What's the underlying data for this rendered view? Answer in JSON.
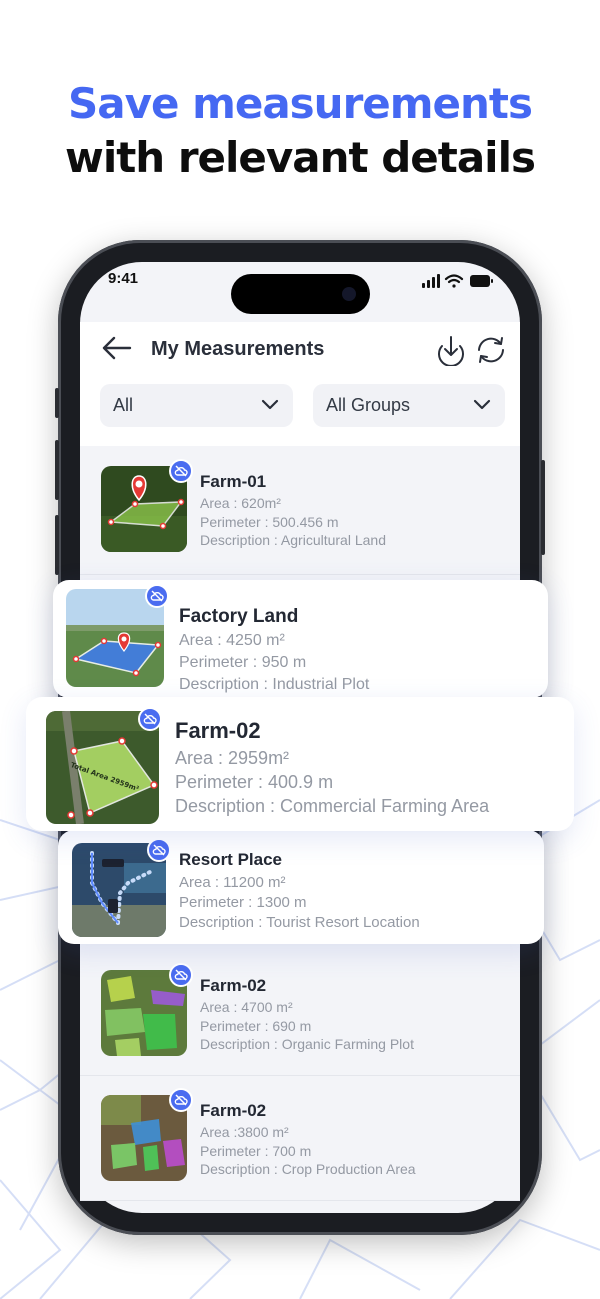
{
  "headline": {
    "line1": "Save measurements",
    "line2": "with relevant details"
  },
  "status_bar": {
    "time": "9:41",
    "icons": [
      "signal-icon",
      "wifi-icon",
      "battery-icon"
    ]
  },
  "header": {
    "title": "My Measurements",
    "back_icon": "back-arrow-icon",
    "download_icon": "download-icon",
    "sync_icon": "sync-icon"
  },
  "filters": {
    "type": {
      "selected": "All"
    },
    "group": {
      "selected": "All Groups"
    }
  },
  "measurements": [
    {
      "name": "Farm-01",
      "area": "Area : 620m²",
      "perimeter": "Perimeter : 500.456 m",
      "description": "Description : Agricultural Land",
      "badge_icon": "cloud-off-icon"
    },
    {
      "name": "Factory Land",
      "area": "Area : 4250 m²",
      "perimeter": "Perimeter : 950 m",
      "description": "Description : Industrial Plot",
      "badge_icon": "cloud-off-icon"
    },
    {
      "name": "Farm-02",
      "area": "Area : 2959m²",
      "perimeter": "Perimeter : 400.9 m",
      "description": "Description : Commercial Farming Area",
      "badge_icon": "cloud-off-icon",
      "map_label": "Total Area 2959m²"
    },
    {
      "name": "Resort Place",
      "area": "Area : 11200 m²",
      "perimeter": "Perimeter : 1300 m",
      "description": "Description : Tourist Resort Location",
      "badge_icon": "cloud-off-icon"
    },
    {
      "name": "Farm-02",
      "area": "Area : 4700 m²",
      "perimeter": "Perimeter : 690 m",
      "description": "Description : Organic Farming Plot",
      "badge_icon": "cloud-off-icon"
    },
    {
      "name": "Farm-02",
      "area": "Area :3800 m²",
      "perimeter": "Perimeter : 700 m",
      "description": "Description : Crop Production Area",
      "badge_icon": "cloud-off-icon"
    }
  ],
  "colors": {
    "accent": "#4568f2",
    "headline_dark": "#0d0d0d",
    "badge": "#4a6cf0",
    "pin_red": "#e53935"
  }
}
